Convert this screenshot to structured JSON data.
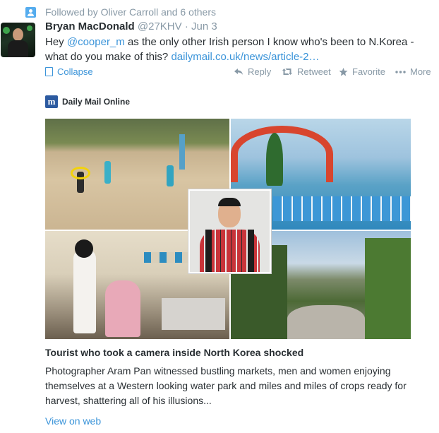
{
  "context": {
    "text": "Followed by Oliver Carroll and 6 others",
    "icon": "person-icon"
  },
  "tweet": {
    "author_name": "Bryan MacDonald",
    "handle": "@27KHV",
    "separator": "·",
    "date": "Jun 3",
    "text_before": "Hey ",
    "mention": "@cooper_m",
    "text_after": " as the only other Irish person I know who's been to N.Korea - what do you make of this? ",
    "link": "dailymail.co.uk/news/article-2…"
  },
  "actions": {
    "collapse": "Collapse",
    "reply": "Reply",
    "retweet": "Retweet",
    "favorite": "Favorite",
    "more": "More"
  },
  "card": {
    "source_logo": "m",
    "source_name": "Daily Mail Online",
    "title": "Tourist who took a camera inside North Korea shocked",
    "description": "Photographer Aram Pan witnessed bustling markets, men and women enjoying themselves at a Western looking water park and miles and miles of crops ready for harvest, shattering all of his illusions...",
    "view_link": "View on web"
  },
  "colors": {
    "link": "#3b94d9",
    "muted": "#8899a6",
    "text": "#292f33",
    "context_icon": "#55acee"
  }
}
